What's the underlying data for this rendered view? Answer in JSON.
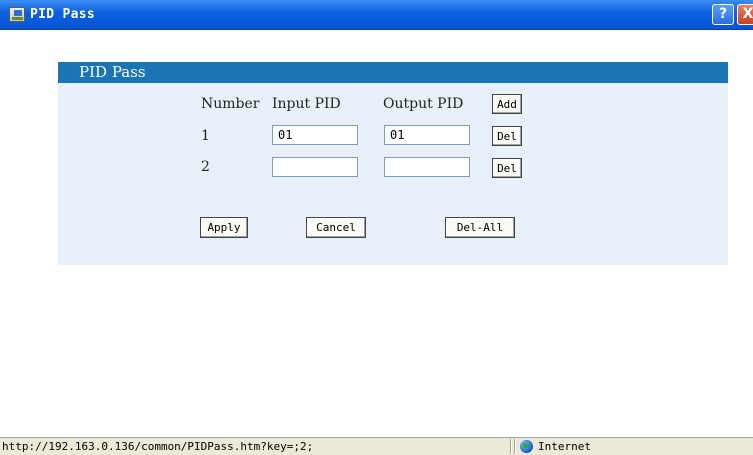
{
  "window": {
    "title": "PID Pass",
    "help_label": "?",
    "close_label": "X"
  },
  "panel": {
    "header": "PID Pass",
    "columns": {
      "number": "Number",
      "input_pid": "Input PID",
      "output_pid": "Output PID"
    },
    "add_label": "Add",
    "rows": [
      {
        "number": "1",
        "input_pid": "01",
        "output_pid": "01",
        "del_label": "Del"
      },
      {
        "number": "2",
        "input_pid": "",
        "output_pid": "",
        "del_label": "Del"
      }
    ],
    "actions": {
      "apply": "Apply",
      "cancel": "Cancel",
      "del_all": "Del-All"
    }
  },
  "statusbar": {
    "url": "http://192.163.0.136/common/PIDPass.htm?key=;2;",
    "zone": "Internet"
  },
  "colors": {
    "titlebar": "#0a5fe0",
    "panel_header": "#1b75b4",
    "panel_bg": "#e8f1fa"
  }
}
